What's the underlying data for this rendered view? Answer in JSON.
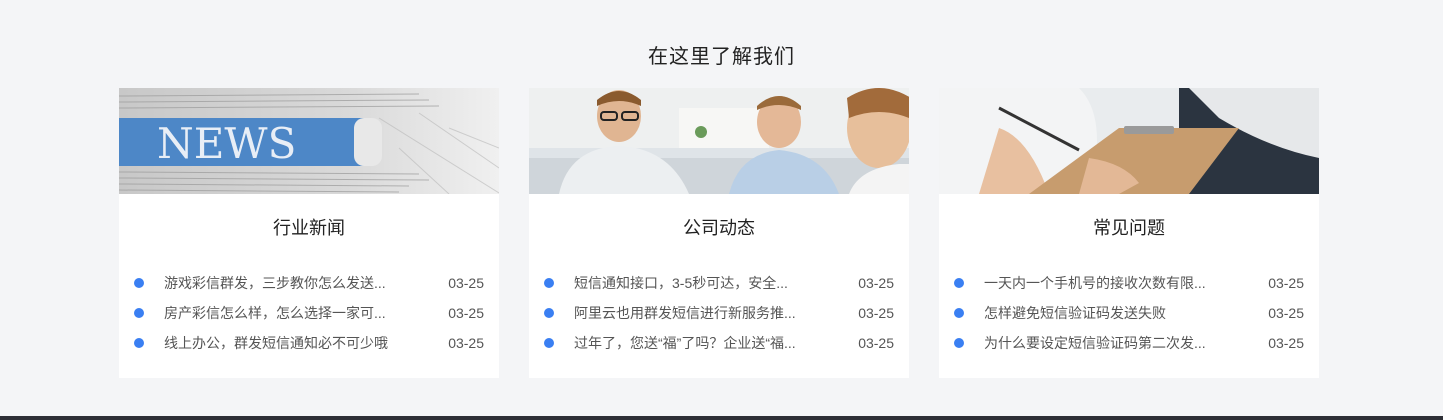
{
  "section": {
    "title": "在这里了解我们"
  },
  "cards": [
    {
      "title": "行业新闻",
      "image_alt": "newspaper-image",
      "image_text": "NEWS",
      "items": [
        {
          "text": "游戏彩信群发，三步教你怎么发送...",
          "date": "03-25"
        },
        {
          "text": "房产彩信怎么样，怎么选择一家可...",
          "date": "03-25"
        },
        {
          "text": "线上办公，群发短信通知必不可少哦",
          "date": "03-25"
        }
      ]
    },
    {
      "title": "公司动态",
      "image_alt": "team-meeting-image",
      "items": [
        {
          "text": "短信通知接口，3-5秒可达，安全...",
          "date": "03-25"
        },
        {
          "text": "阿里云也用群发短信进行新服务推...",
          "date": "03-25"
        },
        {
          "text": "过年了，您送“福”了吗？企业送“福...",
          "date": "03-25"
        }
      ]
    },
    {
      "title": "常见问题",
      "image_alt": "clipboard-writing-image",
      "items": [
        {
          "text": "一天内一个手机号的接收次数有限...",
          "date": "03-25"
        },
        {
          "text": "怎样避免短信验证码发送失败",
          "date": "03-25"
        },
        {
          "text": "为什么要设定短信验证码第二次发...",
          "date": "03-25"
        }
      ]
    }
  ],
  "colors": {
    "bullet": "#3a7ff2",
    "background": "#f4f5f7",
    "card": "#ffffff"
  }
}
